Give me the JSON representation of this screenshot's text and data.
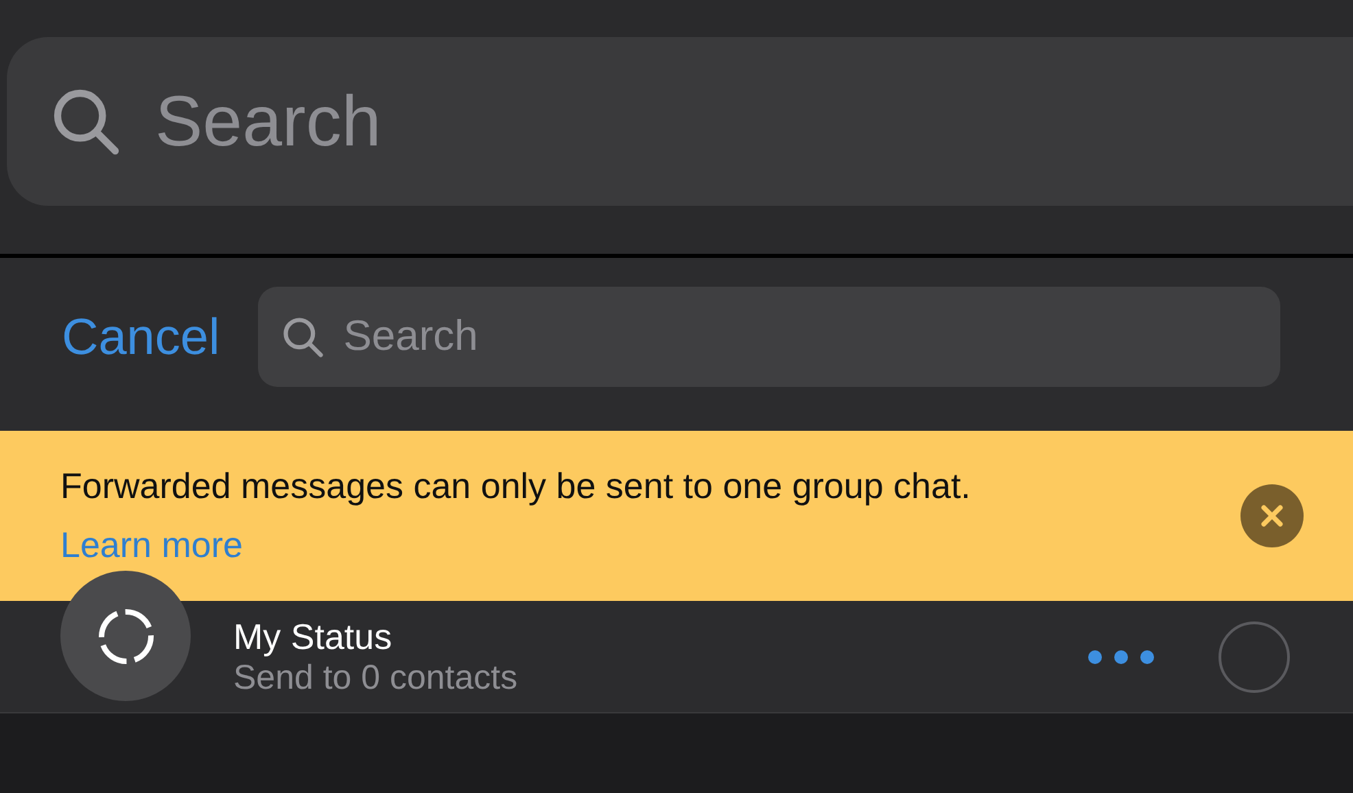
{
  "top_search": {
    "placeholder": "Search"
  },
  "header": {
    "cancel": "Cancel",
    "search": {
      "placeholder": "Search"
    }
  },
  "banner": {
    "message": "Forwarded messages can only be sent to one group chat.",
    "link": "Learn more"
  },
  "rows": [
    {
      "title": "My Status",
      "subtitle": "Send to 0 contacts",
      "selected": false
    }
  ]
}
